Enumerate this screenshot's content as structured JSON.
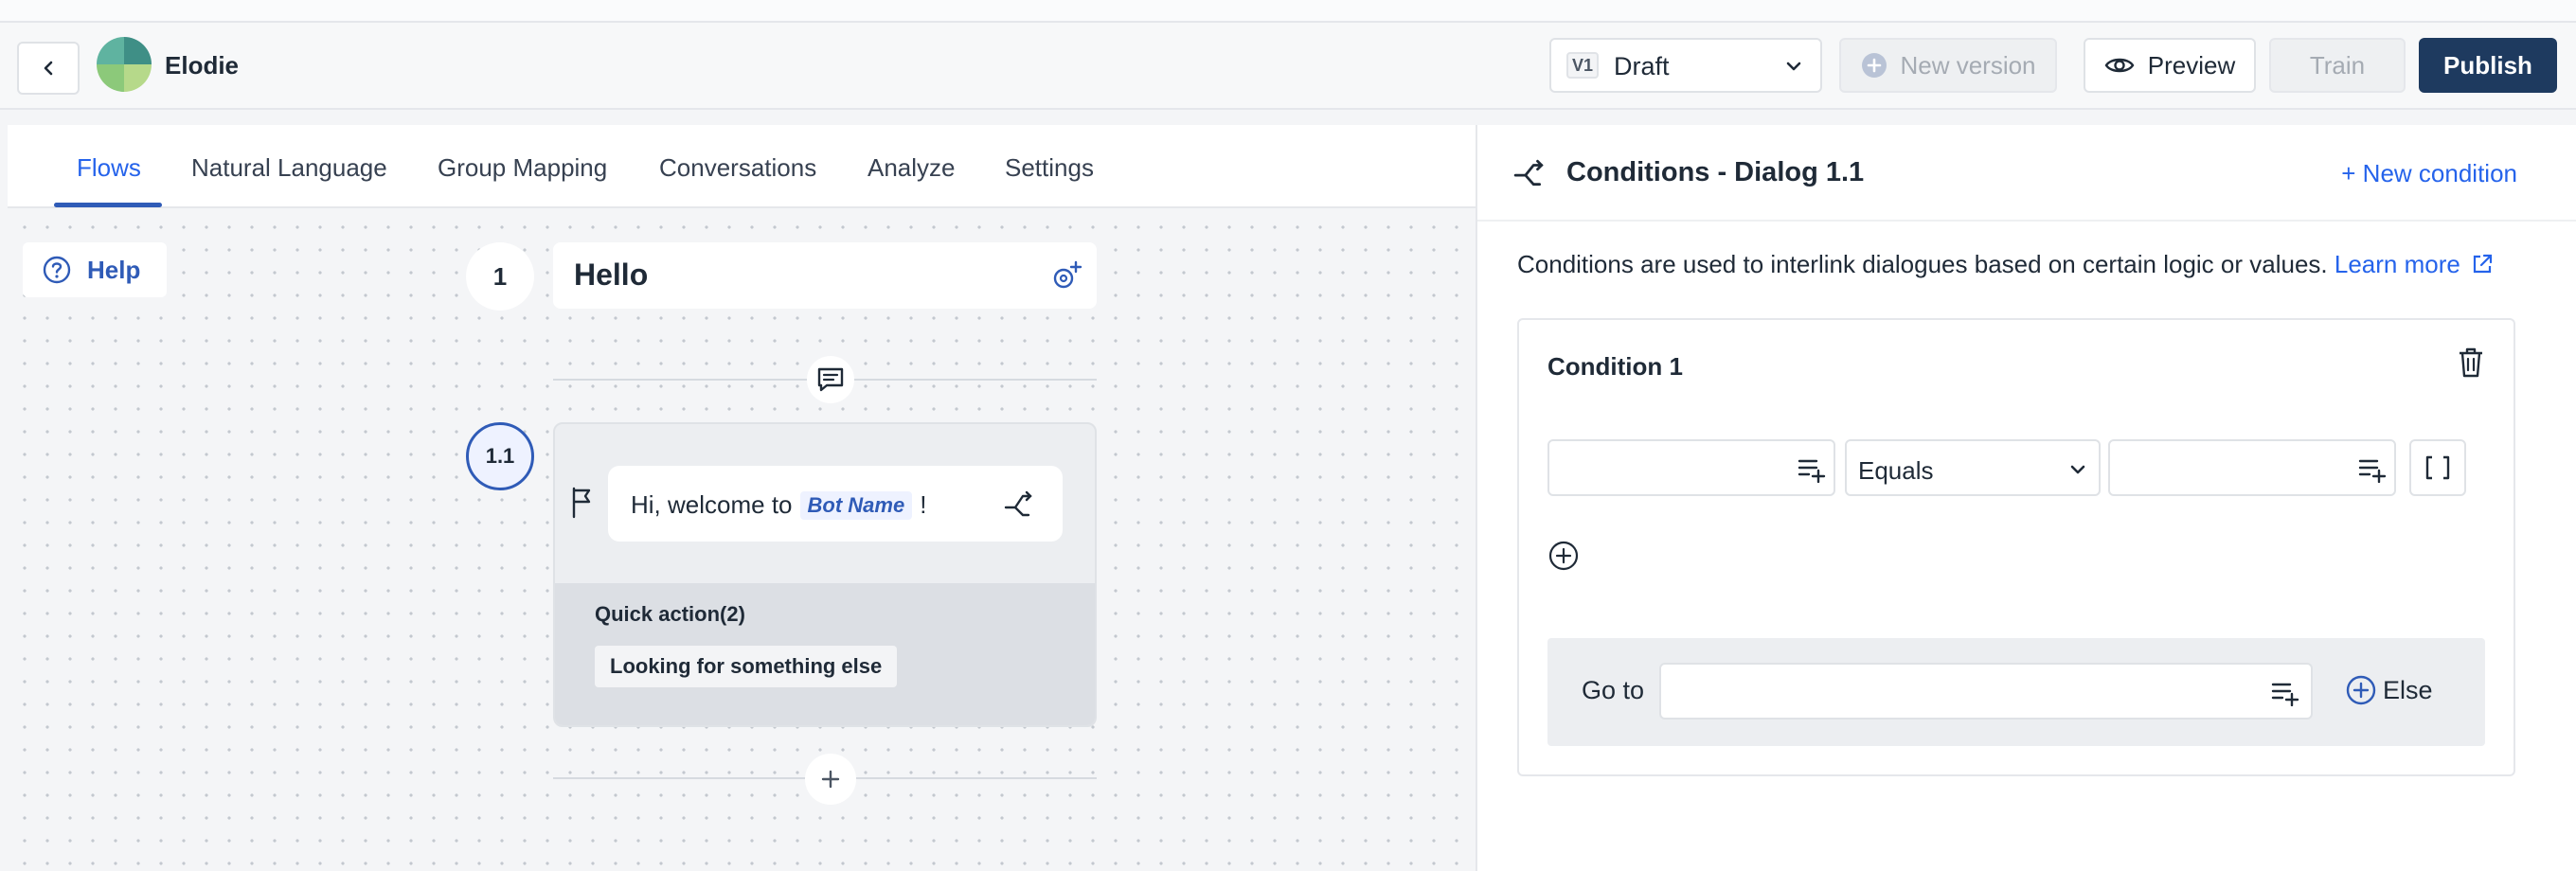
{
  "header": {
    "bot_name": "Elodie",
    "version_badge": "V1",
    "version_state": "Draft",
    "new_version_label": "New version",
    "preview_label": "Preview",
    "train_label": "Train",
    "publish_label": "Publish"
  },
  "tabs": [
    {
      "label": "Flows",
      "active": true
    },
    {
      "label": "Natural Language",
      "active": false
    },
    {
      "label": "Group Mapping",
      "active": false
    },
    {
      "label": "Conversations",
      "active": false
    },
    {
      "label": "Analyze",
      "active": false
    },
    {
      "label": "Settings",
      "active": false
    }
  ],
  "canvas": {
    "help_label": "Help",
    "flow_number": "1",
    "flow_title": "Hello",
    "node_number": "1.1",
    "message_prefix": "Hi, welcome to",
    "message_variable": "Bot Name",
    "message_suffix": "!",
    "quick_action_label": "Quick action(2)",
    "quick_action_chip": "Looking for something else"
  },
  "panel": {
    "title": "Conditions - Dialog 1.1",
    "new_condition_label": "+ New condition",
    "description": "Conditions are used to interlink dialogues based on certain logic or values.",
    "learn_more_label": "Learn more",
    "condition_title": "Condition 1",
    "left_operand_value": "",
    "operator_value": "Equals",
    "right_operand_value": "",
    "goto_label": "Go to",
    "goto_value": "",
    "else_label": "Else"
  },
  "colors": {
    "accent": "#2563eb",
    "primary_dark": "#1e3a5f",
    "node_border": "#2f5bb7"
  }
}
